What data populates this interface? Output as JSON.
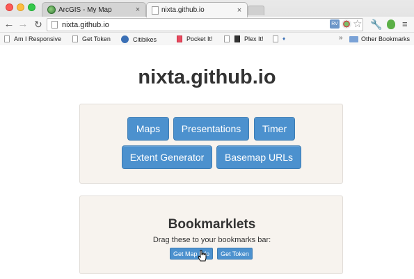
{
  "browser": {
    "tabs": [
      {
        "title": "ArcGIS - My Map",
        "close": "×",
        "active": false
      },
      {
        "title": "nixta.github.io",
        "close": "×",
        "active": true
      }
    ],
    "address_url": "nixta.github.io",
    "nav": {
      "back": "←",
      "forward": "→",
      "reload": "↻"
    },
    "ext_label": "RV",
    "star": "☆",
    "wrench": "🔧",
    "menu": "≡",
    "bookmarks": [
      {
        "label": "Am I Responsive",
        "icon": "page-icon"
      },
      {
        "label": "Get Token",
        "icon": "page-icon"
      },
      {
        "label": "Citibikes",
        "icon": "bike-icon"
      },
      {
        "label": "Pocket It!",
        "icon": "pocket-icon"
      },
      {
        "label": "Plex It!",
        "icon": "plex-icon"
      },
      {
        "label": "",
        "icon": "heart-icon"
      }
    ],
    "bookmarks_overflow": "»",
    "other_bookmarks": "Other Bookmarks"
  },
  "page": {
    "title": "nixta.github.io",
    "nav_buttons": [
      "Maps",
      "Presentations",
      "Timer",
      "Extent Generator",
      "Basemap URLs"
    ],
    "bookmarklets": {
      "heading": "Bookmarklets",
      "instructions": "Drag these to your bookmarks bar:",
      "buttons": [
        "Get Map Info",
        "Get Token"
      ]
    }
  },
  "colors": {
    "button": "#4c91ce",
    "well": "#f7f3ee",
    "text": "#333333"
  }
}
